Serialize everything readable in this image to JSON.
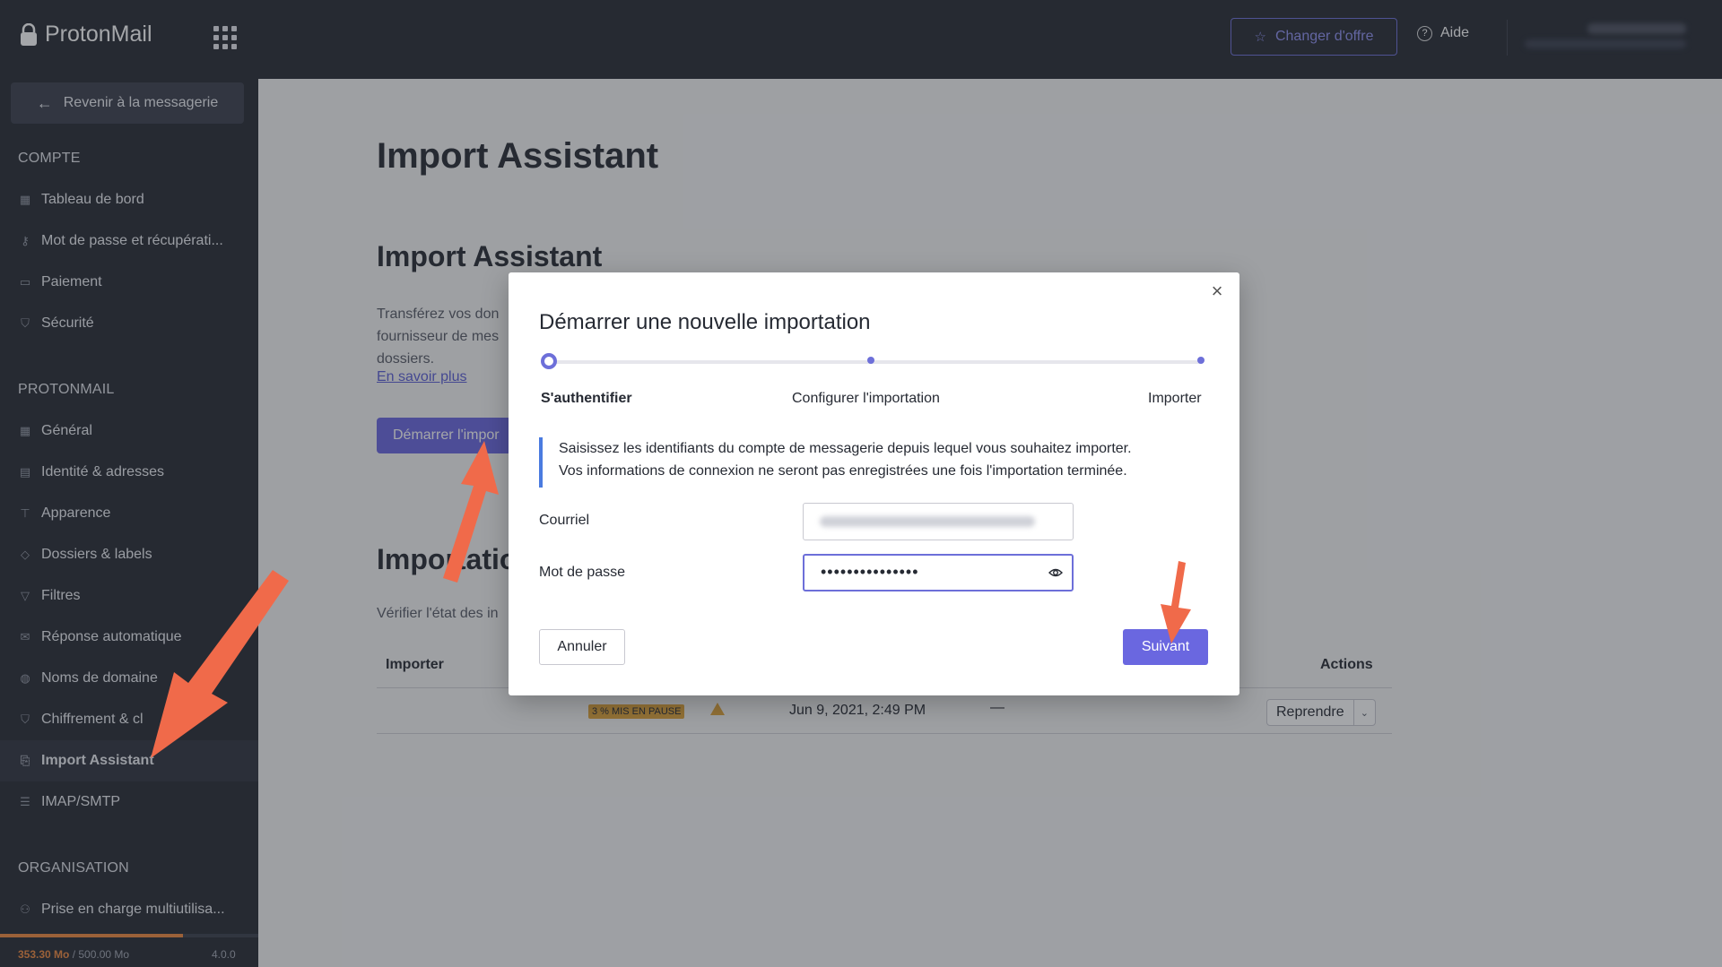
{
  "app": {
    "brand": "ProtonMail",
    "upgrade_label": "Changer d'offre",
    "help_label": "Aide"
  },
  "sidebar": {
    "back_label": "Revenir à la messagerie",
    "sections": [
      {
        "title": "COMPTE",
        "items": [
          {
            "label": "Tableau de bord",
            "icon": "grid-icon"
          },
          {
            "label": "Mot de passe et récupérati...",
            "icon": "key-icon"
          },
          {
            "label": "Paiement",
            "icon": "credit-card-icon"
          },
          {
            "label": "Sécurité",
            "icon": "shield-icon"
          }
        ]
      },
      {
        "title": "PROTONMAIL",
        "items": [
          {
            "label": "Général",
            "icon": "grid-icon"
          },
          {
            "label": "Identité & adresses",
            "icon": "id-card-icon"
          },
          {
            "label": "Apparence",
            "icon": "paint-roller-icon"
          },
          {
            "label": "Dossiers & labels",
            "icon": "tag-icon"
          },
          {
            "label": "Filtres",
            "icon": "filter-icon"
          },
          {
            "label": "Réponse automatique",
            "icon": "envelope-icon"
          },
          {
            "label": "Noms de domaine",
            "icon": "globe-icon"
          },
          {
            "label": "Chiffrement & cl",
            "icon": "shield-icon"
          },
          {
            "label": "Import Assistant",
            "icon": "import-icon",
            "active": true
          },
          {
            "label": "IMAP/SMTP",
            "icon": "server-icon"
          }
        ]
      },
      {
        "title": "ORGANISATION",
        "items": [
          {
            "label": "Prise en charge multiutilisa...",
            "icon": "users-icon"
          }
        ]
      }
    ],
    "storage": {
      "used": "353.30 Mo",
      "total": "/ 500.00 Mo",
      "fraction": 0.71
    },
    "version": "4.0.0"
  },
  "main": {
    "title": "Import Assistant",
    "section_title": "Import Assistant",
    "description": "Transférez vos don fournisseur de mes dossiers.",
    "learn_more": "En savoir plus",
    "start_button": "Démarrer l'impor",
    "imports_title": "Importatio",
    "verify_text": "Vérifier l'état des in",
    "table": {
      "col_importer": "Importer",
      "col_actions": "Actions",
      "row": {
        "status_badge": "3 % MIS EN PAUSE",
        "date": "Jun 9, 2021, 2:49 PM",
        "size": "—",
        "action": "Reprendre"
      }
    }
  },
  "modal": {
    "title": "Démarrer une nouvelle importation",
    "steps": [
      "S'authentifier",
      "Configurer l'importation",
      "Importer"
    ],
    "info_line1": "Saisissez les identifiants du compte de messagerie depuis lequel vous souhaitez importer.",
    "info_line2": "Vos informations de connexion ne seront pas enregistrées une fois l'importation terminée.",
    "email_label": "Courriel",
    "password_label": "Mot de passe",
    "password_mask": "•••••••••••••••",
    "cancel_label": "Annuler",
    "next_label": "Suivant"
  },
  "colors": {
    "accent": "#6a67e0",
    "sidebar_bg": "#262a33",
    "warning": "#e0a43a",
    "annotation": "#f06a4a"
  }
}
